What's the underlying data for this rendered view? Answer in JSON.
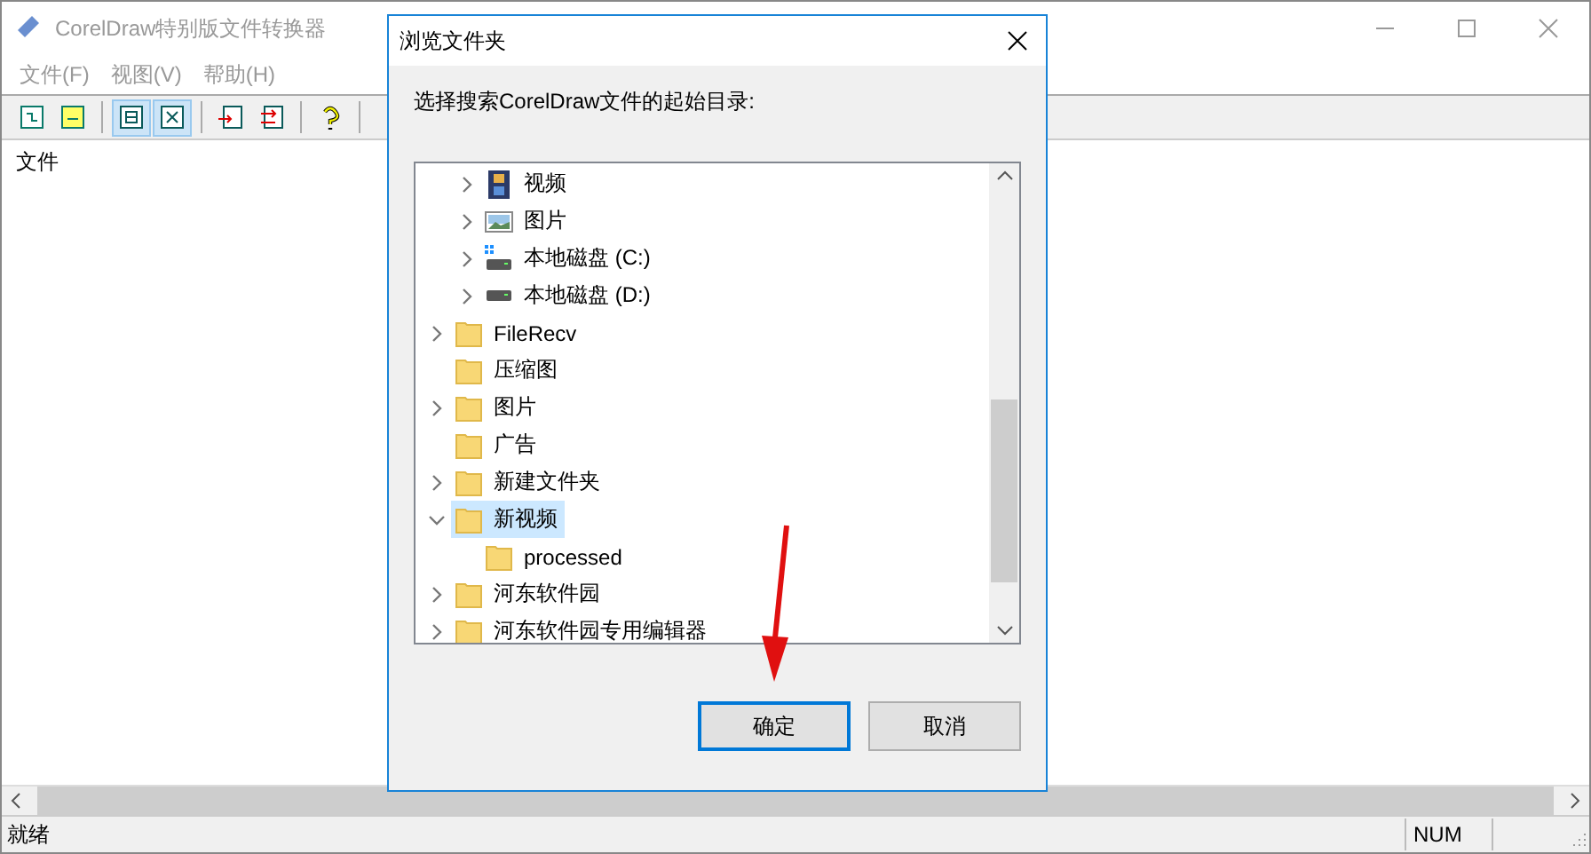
{
  "window": {
    "title": "CorelDraw特别版文件转换器"
  },
  "menu": [
    "文件(F)",
    "视图(V)",
    "帮助(H)"
  ],
  "toolbar": [
    {
      "kind": "doc",
      "pressed": false
    },
    {
      "kind": "doc-yellow",
      "pressed": false
    },
    {
      "kind": "grid",
      "pressed": true
    },
    {
      "kind": "grid-x",
      "pressed": true
    },
    {
      "kind": "import",
      "pressed": false
    },
    {
      "kind": "convert",
      "pressed": false
    },
    {
      "kind": "help",
      "pressed": false
    }
  ],
  "list_header": "文件",
  "status_bar": [
    "就绪",
    "NUM"
  ],
  "dialog": {
    "title": "浏览文件夹",
    "prompt": "选择搜索CorelDraw文件的起始目录:",
    "tree": [
      {
        "kind": "scrolled-parent",
        "children": [
          {
            "label": "视频",
            "kind": "video",
            "expandable": true,
            "expanded": false,
            "selected": false
          },
          {
            "label": "图片",
            "kind": "pictures",
            "expandable": true,
            "expanded": false,
            "selected": false
          },
          {
            "label": "本地磁盘 (C:)",
            "kind": "system-drive",
            "expandable": true,
            "expanded": false,
            "selected": false
          },
          {
            "label": "本地磁盘 (D:)",
            "kind": "drive",
            "expandable": true,
            "expanded": false,
            "selected": false
          }
        ]
      },
      {
        "label": "FileRecv",
        "kind": "folder",
        "expandable": true,
        "expanded": false,
        "selected": false
      },
      {
        "label": "压缩图",
        "kind": "folder",
        "expandable": false,
        "expanded": false,
        "selected": false
      },
      {
        "label": "图片",
        "kind": "folder",
        "expandable": true,
        "expanded": false,
        "selected": false
      },
      {
        "label": "广告",
        "kind": "folder",
        "expandable": false,
        "expanded": false,
        "selected": false
      },
      {
        "label": "新建文件夹",
        "kind": "folder",
        "expandable": true,
        "expanded": false,
        "selected": false
      },
      {
        "label": "新视频",
        "kind": "folder",
        "expandable": true,
        "expanded": true,
        "selected": true,
        "children": [
          {
            "label": "processed",
            "kind": "folder",
            "expandable": false,
            "expanded": false,
            "selected": false
          }
        ]
      },
      {
        "label": "河东软件园",
        "kind": "folder",
        "expandable": true,
        "expanded": false,
        "selected": false
      },
      {
        "label": "河东软件园专用编辑器",
        "kind": "folder",
        "expandable": true,
        "expanded": false,
        "selected": false
      }
    ],
    "buttons": [
      {
        "label": "确定",
        "default": true
      },
      {
        "label": "取消",
        "default": false
      }
    ]
  }
}
